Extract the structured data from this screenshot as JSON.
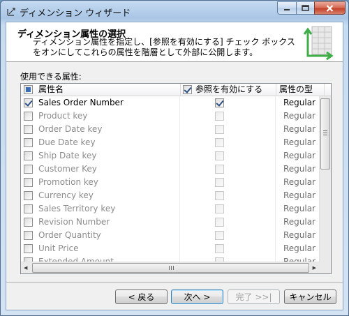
{
  "window": {
    "title": "ディメンション ウィザード"
  },
  "header": {
    "title": "ディメンション属性の選択",
    "description": "ディメンション属性を指定し、[参照を有効にする] チェック ボックスをオンにしてこれらの属性を階層として外部に公開します。"
  },
  "attributes_label": "使用できる属性:",
  "grid": {
    "columns": {
      "name": "属性名",
      "enable_browsing": "参照を有効にする",
      "type": "属性の型"
    },
    "rows": [
      {
        "name": "Sales Order Number",
        "type": "Regular",
        "selected": true,
        "browse": true
      },
      {
        "name": "Product key",
        "type": "Regular",
        "selected": false,
        "browse": false
      },
      {
        "name": "Order Date key",
        "type": "Regular",
        "selected": false,
        "browse": false
      },
      {
        "name": "Due Date key",
        "type": "Regular",
        "selected": false,
        "browse": false
      },
      {
        "name": "Ship Date key",
        "type": "Regular",
        "selected": false,
        "browse": false
      },
      {
        "name": "Customer Key",
        "type": "Regular",
        "selected": false,
        "browse": false
      },
      {
        "name": "Promotion key",
        "type": "Regular",
        "selected": false,
        "browse": false
      },
      {
        "name": "Currency key",
        "type": "Regular",
        "selected": false,
        "browse": false
      },
      {
        "name": "Sales Territory key",
        "type": "Regular",
        "selected": false,
        "browse": false
      },
      {
        "name": "Revision Number",
        "type": "Regular",
        "selected": false,
        "browse": false
      },
      {
        "name": "Order Quantity",
        "type": "Regular",
        "selected": false,
        "browse": false
      },
      {
        "name": "Unit Price",
        "type": "Regular",
        "selected": false,
        "browse": false
      },
      {
        "name": "Extended Amount",
        "type": "Regular",
        "selected": false,
        "browse": false
      }
    ]
  },
  "buttons": {
    "back": "< 戻る",
    "next": "次へ >",
    "finish": "完了 >>|",
    "cancel": "キャンセル"
  }
}
